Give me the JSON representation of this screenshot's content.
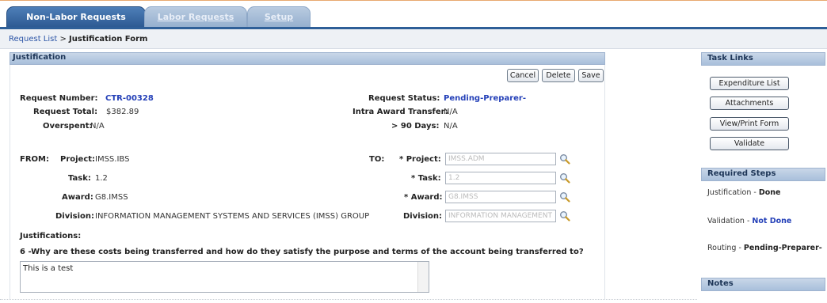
{
  "tabs": [
    {
      "label": "Non-Labor Requests"
    },
    {
      "label": "Labor Requests"
    },
    {
      "label": "Setup"
    }
  ],
  "breadcrumb": {
    "link": "Request List",
    "sep": " > ",
    "current": "Justification Form"
  },
  "justification": {
    "title": "Justification",
    "buttons": {
      "cancel": "Cancel",
      "delete": "Delete",
      "save": "Save"
    },
    "request_number_label": "Request Number:",
    "request_number": "CTR-00328",
    "request_total_label": "Request Total:",
    "request_total": "$382.89",
    "overspent_label": "Overspent:",
    "overspent": "N/A",
    "request_status_label": "Request Status:",
    "request_status": "Pending-Preparer-",
    "intra_award_label": "Intra Award Transfer:",
    "intra_award": "N/A",
    "days_label": "> 90 Days:",
    "days": "N/A",
    "from_label": "FROM:",
    "from_project_label": "Project:",
    "from_project": "IMSS.IBS",
    "from_task_label": "Task:",
    "from_task": "1.2",
    "from_award_label": "Award:",
    "from_award": "G8.IMSS",
    "from_division_label": "Division:",
    "from_division": "INFORMATION MANAGEMENT SYSTEMS AND SERVICES (IMSS) GROUP",
    "to_label": "TO:",
    "to_project_label": "* Project:",
    "to_project": "IMSS.ADM",
    "to_task_label": "* Task:",
    "to_task": "1.2",
    "to_award_label": "* Award:",
    "to_award": "G8.IMSS",
    "to_division_label": "Division:",
    "to_division": "INFORMATION MANAGEMENT",
    "justifications_label": "Justifications:",
    "question": "6 -Why are these costs being transferred and how do they satisfy the purpose and terms of the account being transferred to?",
    "answer": "This is a test"
  },
  "task_links": {
    "title": "Task Links",
    "items": [
      "Expenditure List",
      "Attachments",
      "View/Print Form",
      "Validate"
    ]
  },
  "required_steps": {
    "title": "Required Steps",
    "steps": [
      {
        "name": "Justification",
        "sep": " - ",
        "status": "Done"
      },
      {
        "name": "Validation",
        "sep": " - ",
        "status": "Not Done"
      },
      {
        "name": "Routing",
        "sep": " - ",
        "status": "Pending-Preparer-"
      }
    ]
  },
  "notes": {
    "title": "Notes"
  },
  "colors": {
    "tab_active": "#2d5a93",
    "link": "#2440b8",
    "header_bg": "#a8bfdb"
  },
  "icons": {
    "lookup": "magnifier-icon"
  }
}
